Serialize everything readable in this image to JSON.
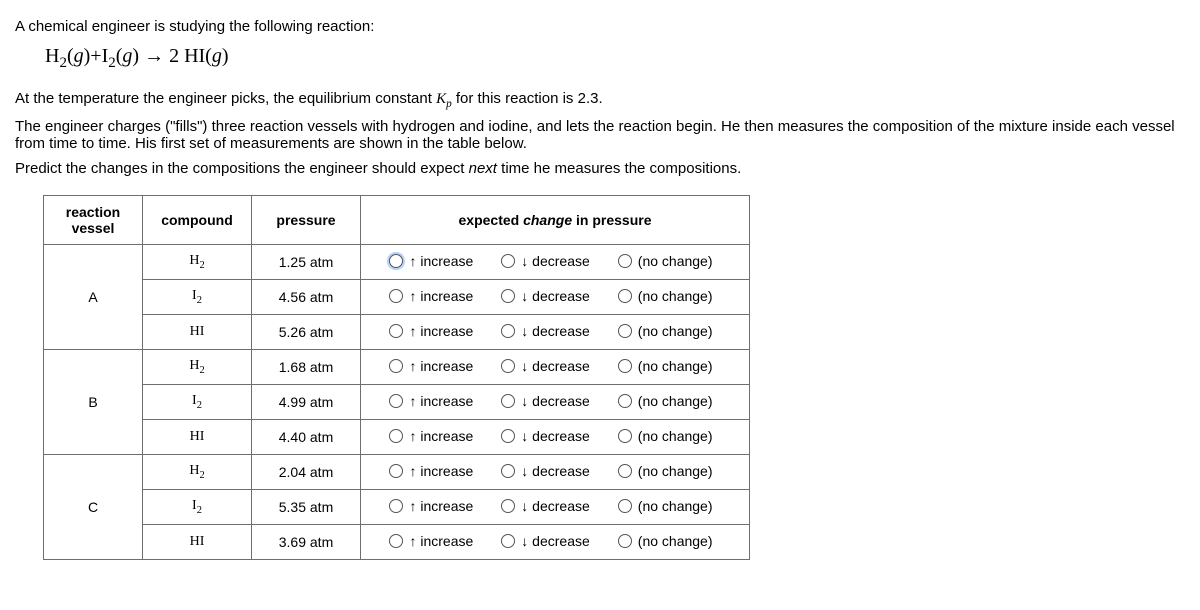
{
  "intro": {
    "line1": "A chemical engineer is studying the following reaction:",
    "equation_html": "H<span class=\"sub\">2</span>(<span class=\"ital\">g</span>)+I<span class=\"sub\">2</span>(<span class=\"ital\">g</span>) → 2 HI(<span class=\"ital\">g</span>)",
    "line2_pre": "At the temperature the engineer picks, the equilibrium constant ",
    "line2_kp_html": "K<span class=\"sub\">p</span>",
    "line2_mid": " for this reaction is ",
    "kp_value": "2.3",
    "line2_post": ".",
    "line3": "The engineer charges (\"fills\") three reaction vessels with hydrogen and iodine, and lets the reaction begin. He then measures the composition of the mixture inside each vessel from time to time. His first set of measurements are shown in the table below.",
    "line4_pre": "Predict the changes in the compositions the engineer should expect ",
    "line4_ital": "next",
    "line4_post": " time he measures the compositions."
  },
  "table": {
    "headers": {
      "vessel": "reaction vessel",
      "compound": "compound",
      "pressure": "pressure",
      "change_pre": "expected ",
      "change_ital": "change",
      "change_post": " in pressure"
    },
    "options": {
      "increase": "↑ increase",
      "decrease": "↓ decrease",
      "nochange": "(no change)"
    },
    "vessels": [
      {
        "name": "A",
        "rows": [
          {
            "compound_html": "H<span class=\"sub\">2</span>",
            "pressure": "1.25 atm",
            "focused": true
          },
          {
            "compound_html": "I<span class=\"sub\">2</span>",
            "pressure": "4.56 atm",
            "focused": false
          },
          {
            "compound_html": "HI",
            "pressure": "5.26 atm",
            "focused": false
          }
        ]
      },
      {
        "name": "B",
        "rows": [
          {
            "compound_html": "H<span class=\"sub\">2</span>",
            "pressure": "1.68 atm",
            "focused": false
          },
          {
            "compound_html": "I<span class=\"sub\">2</span>",
            "pressure": "4.99 atm",
            "focused": false
          },
          {
            "compound_html": "HI",
            "pressure": "4.40 atm",
            "focused": false
          }
        ]
      },
      {
        "name": "C",
        "rows": [
          {
            "compound_html": "H<span class=\"sub\">2</span>",
            "pressure": "2.04 atm",
            "focused": false
          },
          {
            "compound_html": "I<span class=\"sub\">2</span>",
            "pressure": "5.35 atm",
            "focused": false
          },
          {
            "compound_html": "HI",
            "pressure": "3.69 atm",
            "focused": false
          }
        ]
      }
    ]
  }
}
